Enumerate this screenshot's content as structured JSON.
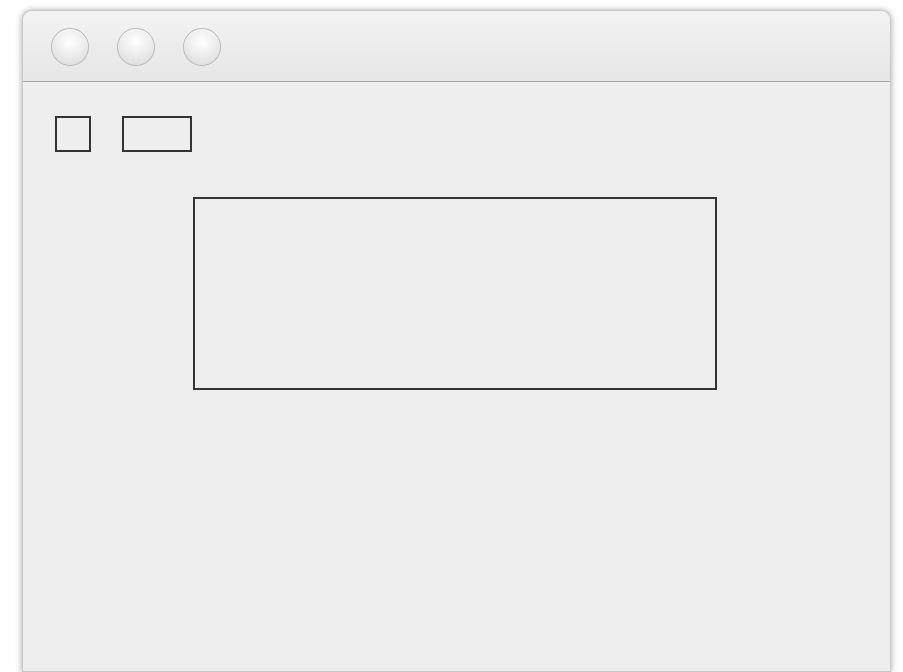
{
  "window": {
    "title": "",
    "traffic_lights": [
      {
        "name": "close",
        "color": "#e8e8e8"
      },
      {
        "name": "minimize",
        "color": "#e8e8e8"
      },
      {
        "name": "zoom",
        "color": "#e8e8e8"
      }
    ],
    "background_color": "#eeeeee",
    "border_color": "#333333"
  },
  "content": {
    "checkbox": {
      "checked": false,
      "label": ""
    },
    "button": {
      "label": ""
    },
    "panel": {
      "text": ""
    }
  }
}
